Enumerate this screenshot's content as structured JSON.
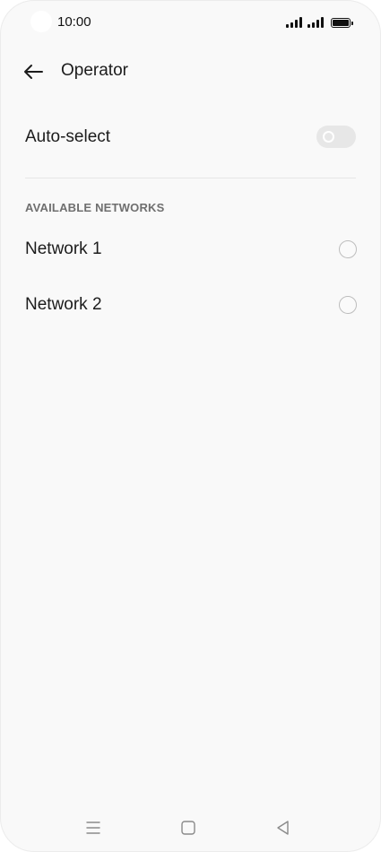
{
  "status_bar": {
    "time": "10:00",
    "icons": [
      "signal-icon",
      "signal-icon",
      "battery-icon"
    ]
  },
  "header": {
    "title": "Operator",
    "back_icon": "back-arrow-icon"
  },
  "settings": {
    "auto_select": {
      "label": "Auto-select",
      "enabled": false
    },
    "section_title": "AVAILABLE NETWORKS",
    "networks": [
      {
        "label": "Network 1",
        "selected": false
      },
      {
        "label": "Network 2",
        "selected": false
      }
    ]
  },
  "nav_bar": {
    "icons": [
      "menu-icon",
      "home-icon",
      "back-triangle-icon"
    ]
  },
  "colors": {
    "background": "#f9f9f9",
    "text": "#1c1c1c",
    "section_text": "#6f6f6f",
    "toggle_off": "#e7e7e7",
    "radio_border": "#bdbdbd"
  }
}
